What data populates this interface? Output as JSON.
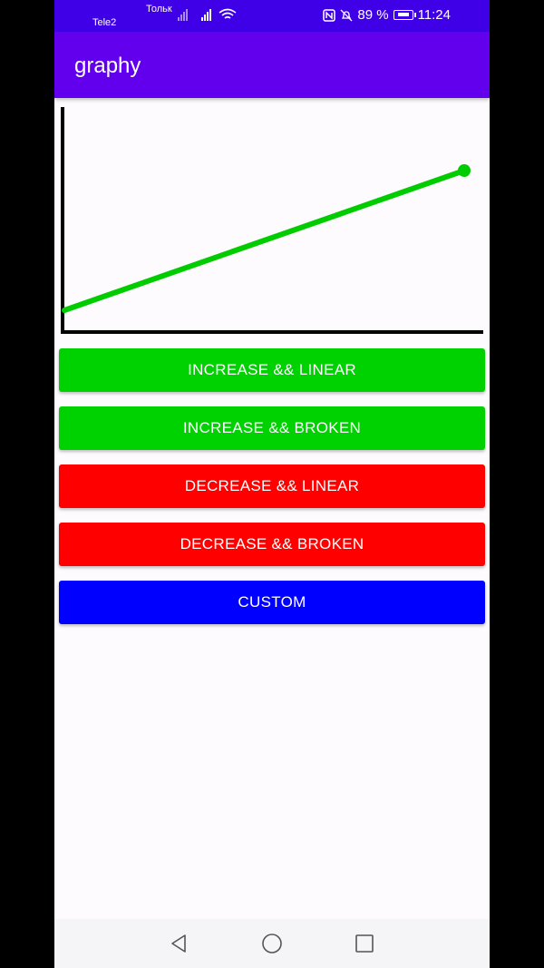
{
  "status_bar": {
    "carrier_top": "Тольк",
    "carrier_bottom": "Tele2",
    "battery_percent": "89 %",
    "time": "11:24",
    "icons": [
      "nfc-icon",
      "mute-icon",
      "battery-charging-icon",
      "wifi-icon",
      "signal-icon"
    ]
  },
  "app_bar": {
    "title": "graphy"
  },
  "chart_data": {
    "type": "line",
    "title": "",
    "xlabel": "",
    "ylabel": "",
    "series": [
      {
        "color": "#00cc00",
        "x": [
          0,
          1
        ],
        "y": [
          0,
          1
        ]
      }
    ],
    "marker_at_end": true,
    "axes_color": "#000000"
  },
  "buttons": [
    {
      "label": "INCREASE && LINEAR",
      "color": "#00d100"
    },
    {
      "label": "INCREASE && BROKEN",
      "color": "#00d100"
    },
    {
      "label": "DECREASE && LINEAR",
      "color": "#ff0000"
    },
    {
      "label": "DECREASE && BROKEN",
      "color": "#ff0000"
    },
    {
      "label": "CUSTOM",
      "color": "#0000ff"
    }
  ],
  "nav_bar": {
    "icons": [
      "back-icon",
      "home-icon",
      "recents-icon"
    ]
  }
}
